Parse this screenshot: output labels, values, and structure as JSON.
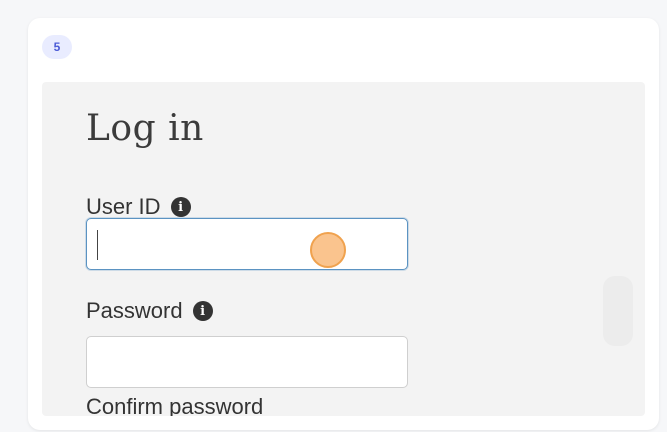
{
  "step": {
    "number": "5"
  },
  "login": {
    "title": "Log in",
    "user_id_label": "User ID",
    "user_id_value": "",
    "password_label": "Password",
    "password_value": "",
    "confirm_label": "Confirm password",
    "info_glyph": "i"
  },
  "colors": {
    "badge_bg": "#e9ecff",
    "badge_text": "#4b5bd6",
    "focus_border": "#5b93c2",
    "cursor_highlight": "#f0a24e"
  }
}
